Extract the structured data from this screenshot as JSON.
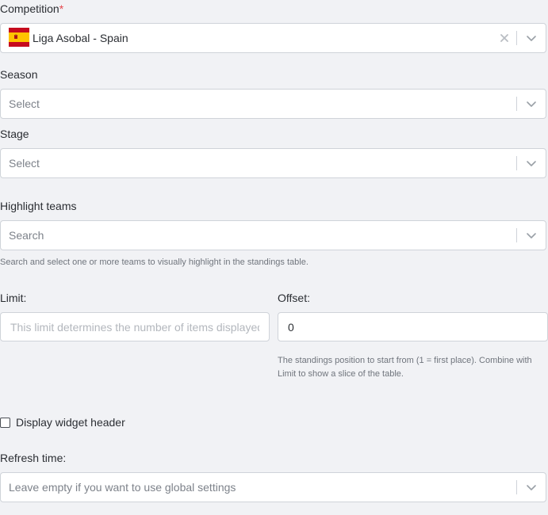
{
  "competition": {
    "label": "Competition",
    "required_mark": "*",
    "value": "Liga Asobal - Spain",
    "flag_icon": "spain-flag-icon",
    "flag_colors": {
      "red": "#c60b1e",
      "yellow": "#ffc400"
    }
  },
  "season": {
    "label": "Season",
    "placeholder": "Select"
  },
  "stage": {
    "label": "Stage",
    "placeholder": "Select"
  },
  "highlight_teams": {
    "label": "Highlight teams",
    "placeholder": "Search",
    "hint": "Search and select one or more teams to visually highlight in the standings table."
  },
  "limit": {
    "label": "Limit:",
    "placeholder": "This limit determines the number of items displayed",
    "value": ""
  },
  "offset": {
    "label": "Offset:",
    "value": "0",
    "hint": "The standings position to start from (1 = first place). Combine with Limit to show a slice of the table."
  },
  "display_header": {
    "label": "Display widget header",
    "checked": false
  },
  "refresh_time": {
    "label": "Refresh time:",
    "placeholder": "Leave empty if you want to use global settings"
  }
}
